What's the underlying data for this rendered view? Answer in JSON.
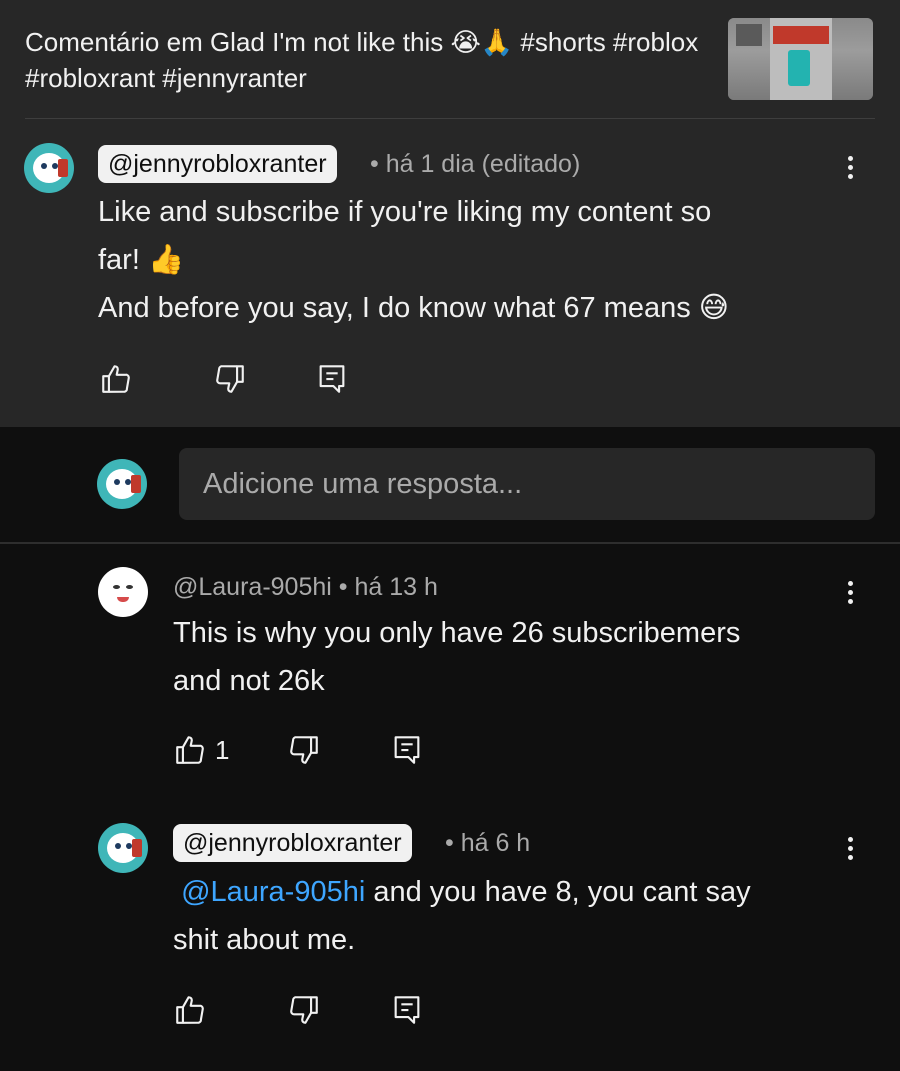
{
  "header": {
    "video_title": "Comentário em Glad I'm not like this 😭🙏 #shorts #roblox #robloxrant #jennyranter"
  },
  "main_comment": {
    "author": "@jennyrobloxranter",
    "meta": "• há 1 dia (editado)",
    "line1": "Like and subscribe if you're liking my content so",
    "line2": "far! 👍",
    "line3": "And before you say, I do know what 67 means 😅"
  },
  "reply_box": {
    "placeholder": "Adicione uma resposta..."
  },
  "replies": [
    {
      "author": "@Laura-905hi",
      "meta": "• há 13 h",
      "line1": "This is why you only have 26 subscribemers",
      "line2": "and not 26k",
      "like_count": "1"
    },
    {
      "author": "@jennyrobloxranter",
      "meta": "• há 6 h",
      "mention": "@Laura-905hi",
      "line1_rest": " and you have 8, you cant say",
      "line2": "shit about me."
    }
  ],
  "icons": {
    "like": "thumbs-up-icon",
    "dislike": "thumbs-down-icon",
    "reply": "comment-reply-icon",
    "more": "more-vertical-icon"
  },
  "colors": {
    "top_background": "#272727",
    "page_background": "#0f0f0f",
    "mention": "#3ea6ff",
    "avatar_teal": "#3fb6b8"
  }
}
